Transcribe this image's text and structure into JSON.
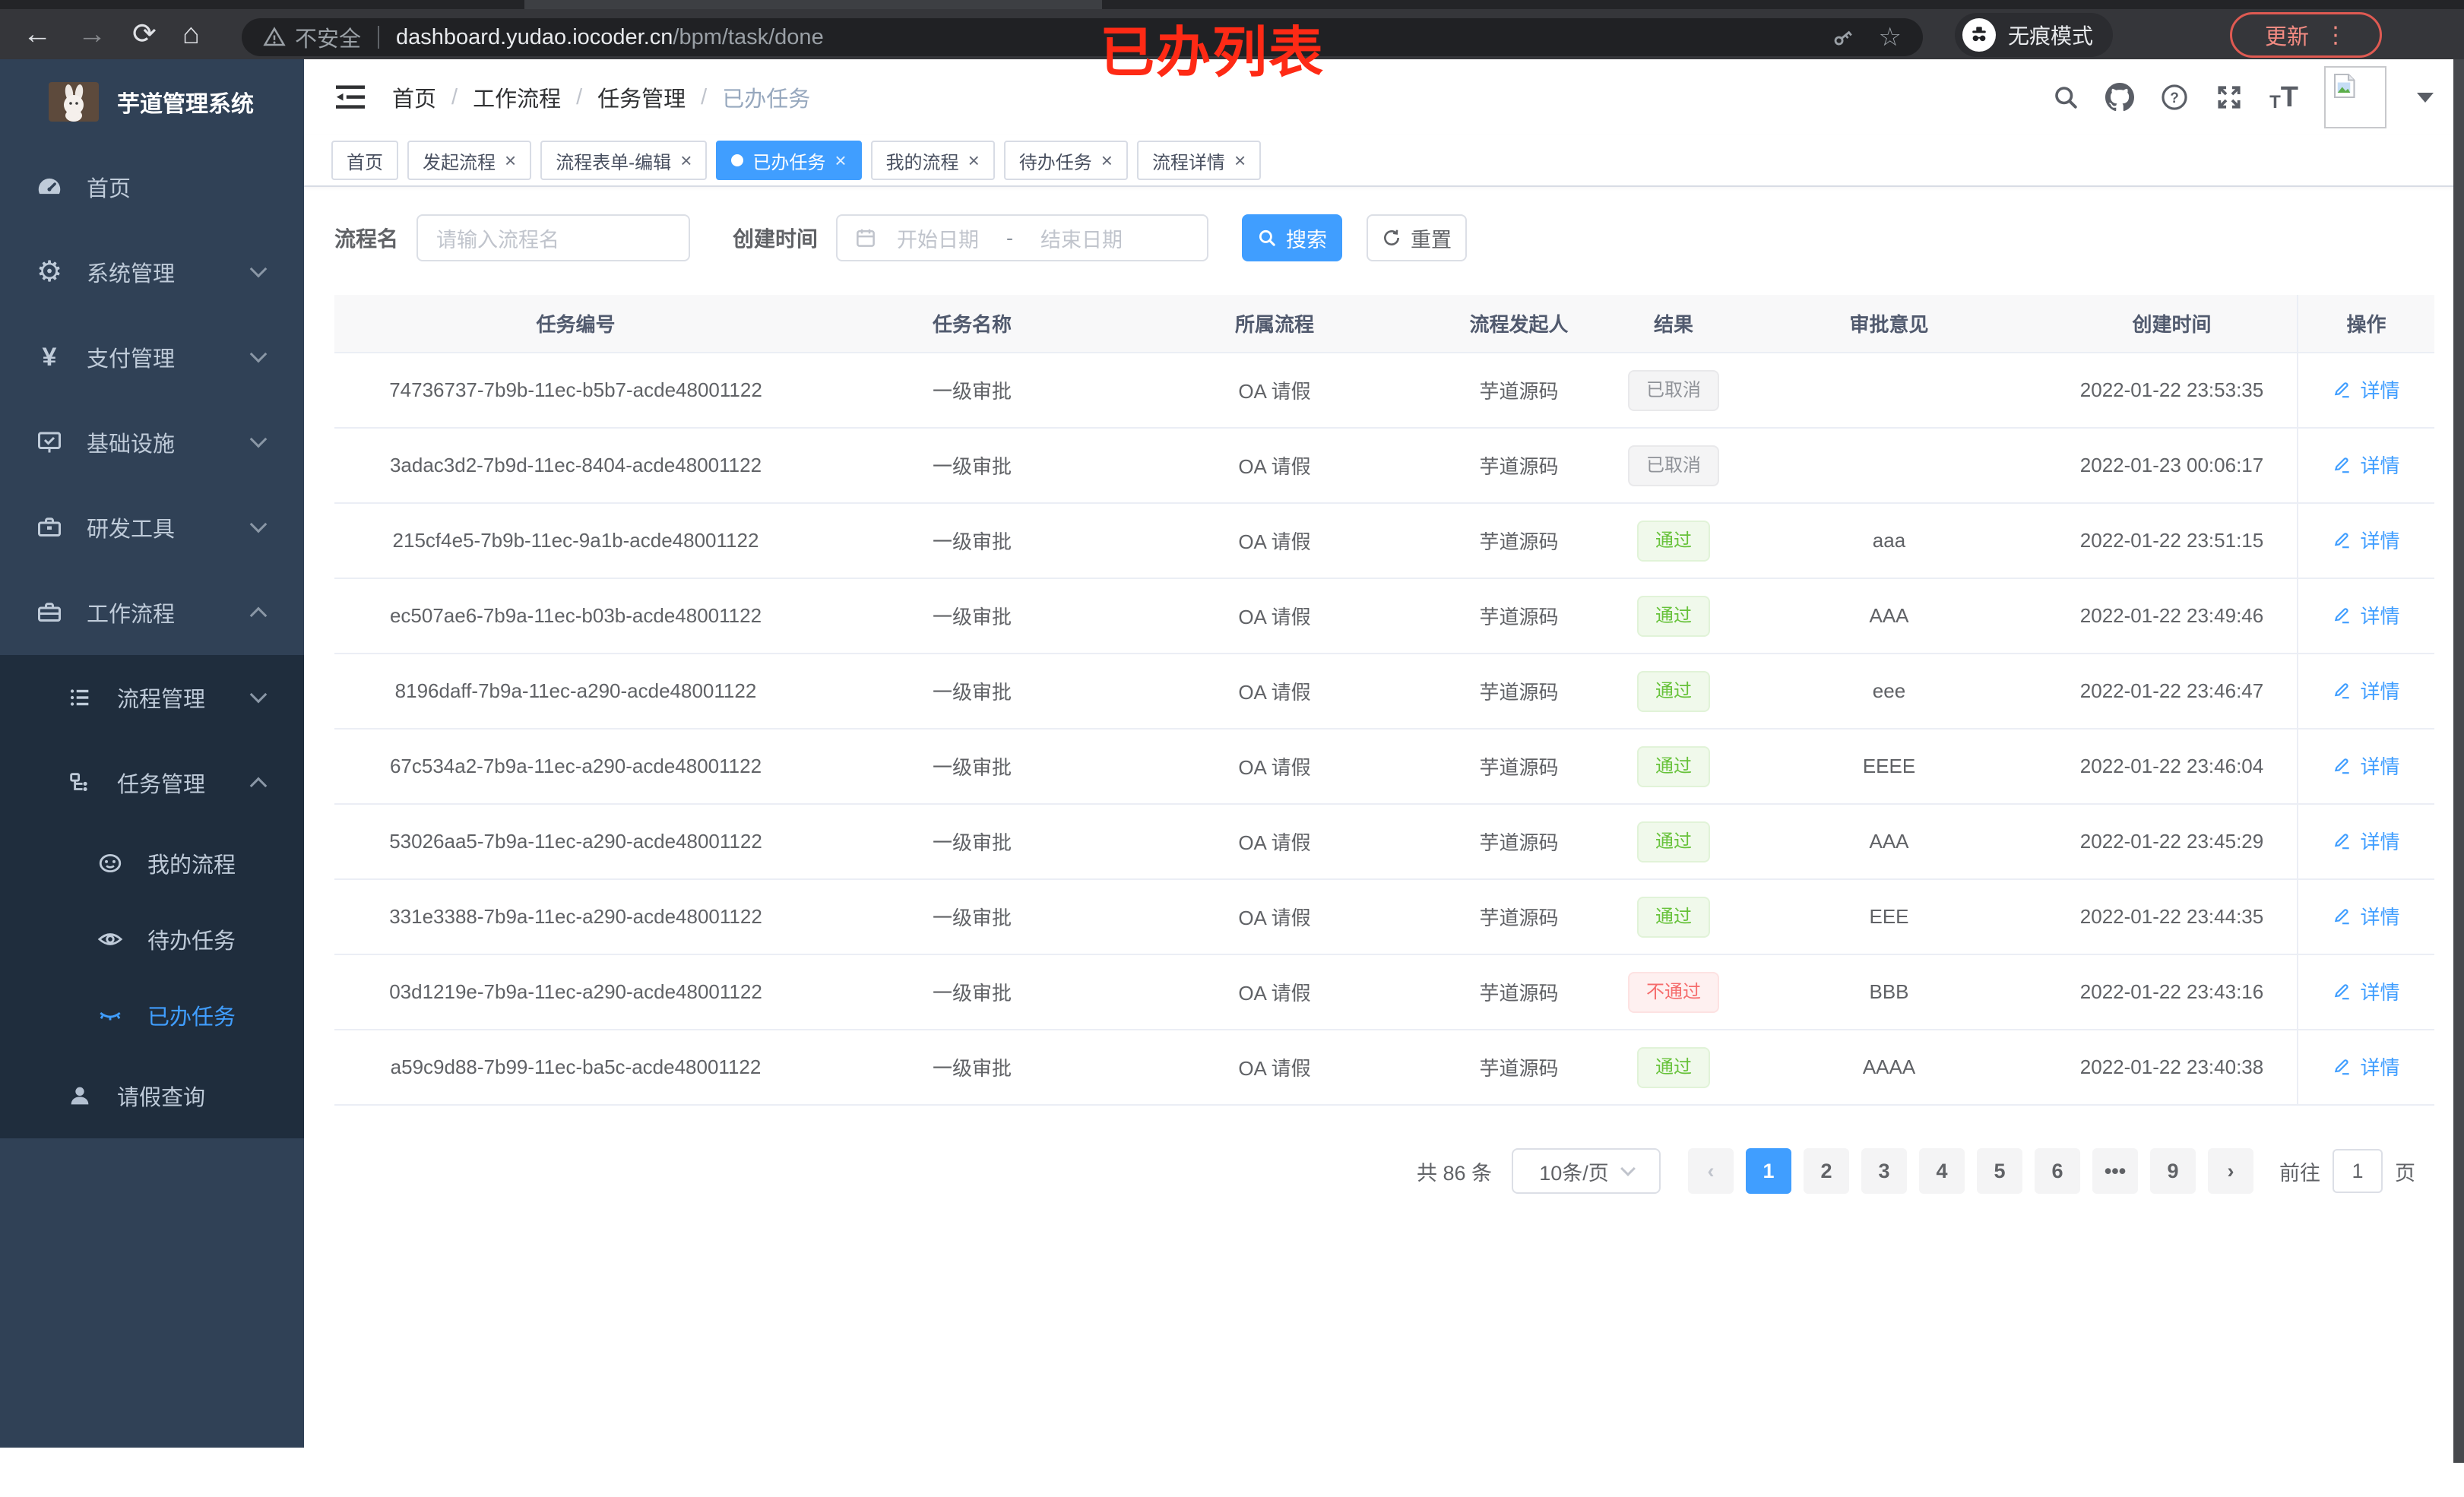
{
  "browser": {
    "security_label": "不安全",
    "url_host": "dashboard.yudao.iocoder.cn",
    "url_path": "/bpm/task/done",
    "incognito_label": "无痕模式",
    "update_label": "更新",
    "kebab": "⋮",
    "back": "←",
    "forward": "→",
    "reload": "⟳",
    "home": "⌂",
    "star": "☆"
  },
  "annotation": "已办列表",
  "sidebar": {
    "title": "芋道管理系统",
    "menu": [
      {
        "label": "首页"
      },
      {
        "label": "系统管理"
      },
      {
        "label": "支付管理"
      },
      {
        "label": "基础设施"
      },
      {
        "label": "研发工具"
      },
      {
        "label": "工作流程"
      },
      {
        "label": "流程管理"
      },
      {
        "label": "任务管理"
      },
      {
        "label": "我的流程"
      },
      {
        "label": "待办任务"
      },
      {
        "label": "已办任务"
      },
      {
        "label": "请假查询"
      }
    ],
    "yen_glyph": "¥",
    "gear_glyph": "⚙"
  },
  "navbar": {
    "breadcrumb": [
      "首页",
      "工作流程",
      "任务管理",
      "已办任务"
    ],
    "separator": "/"
  },
  "tabs": [
    {
      "label": "首页",
      "closable": false,
      "active": false
    },
    {
      "label": "发起流程",
      "closable": true,
      "active": false
    },
    {
      "label": "流程表单-编辑",
      "closable": true,
      "active": false
    },
    {
      "label": "已办任务",
      "closable": true,
      "active": true
    },
    {
      "label": "我的流程",
      "closable": true,
      "active": false
    },
    {
      "label": "待办任务",
      "closable": true,
      "active": false
    },
    {
      "label": "流程详情",
      "closable": true,
      "active": false
    }
  ],
  "filters": {
    "name_label": "流程名",
    "name_placeholder": "请输入流程名",
    "date_label": "创建时间",
    "date_start_placeholder": "开始日期",
    "date_separator": "-",
    "date_end_placeholder": "结束日期",
    "search_label": "搜索",
    "reset_label": "重置"
  },
  "table": {
    "columns": [
      "任务编号",
      "任务名称",
      "所属流程",
      "流程发起人",
      "结果",
      "审批意见",
      "创建时间",
      "操作"
    ],
    "action_label": "详情",
    "rows": [
      {
        "id": "74736737-7b9b-11ec-b5b7-acde48001122",
        "name": "一级审批",
        "process": "OA 请假",
        "starter": "芋道源码",
        "result": "已取消",
        "result_type": "info",
        "comment": "",
        "created": "2022-01-22 23:53:35"
      },
      {
        "id": "3adac3d2-7b9d-11ec-8404-acde48001122",
        "name": "一级审批",
        "process": "OA 请假",
        "starter": "芋道源码",
        "result": "已取消",
        "result_type": "info",
        "comment": "",
        "created": "2022-01-23 00:06:17"
      },
      {
        "id": "215cf4e5-7b9b-11ec-9a1b-acde48001122",
        "name": "一级审批",
        "process": "OA 请假",
        "starter": "芋道源码",
        "result": "通过",
        "result_type": "success",
        "comment": "aaa",
        "created": "2022-01-22 23:51:15"
      },
      {
        "id": "ec507ae6-7b9a-11ec-b03b-acde48001122",
        "name": "一级审批",
        "process": "OA 请假",
        "starter": "芋道源码",
        "result": "通过",
        "result_type": "success",
        "comment": "AAA",
        "created": "2022-01-22 23:49:46"
      },
      {
        "id": "8196daff-7b9a-11ec-a290-acde48001122",
        "name": "一级审批",
        "process": "OA 请假",
        "starter": "芋道源码",
        "result": "通过",
        "result_type": "success",
        "comment": "eee",
        "created": "2022-01-22 23:46:47"
      },
      {
        "id": "67c534a2-7b9a-11ec-a290-acde48001122",
        "name": "一级审批",
        "process": "OA 请假",
        "starter": "芋道源码",
        "result": "通过",
        "result_type": "success",
        "comment": "EEEE",
        "created": "2022-01-22 23:46:04"
      },
      {
        "id": "53026aa5-7b9a-11ec-a290-acde48001122",
        "name": "一级审批",
        "process": "OA 请假",
        "starter": "芋道源码",
        "result": "通过",
        "result_type": "success",
        "comment": "AAA",
        "created": "2022-01-22 23:45:29"
      },
      {
        "id": "331e3388-7b9a-11ec-a290-acde48001122",
        "name": "一级审批",
        "process": "OA 请假",
        "starter": "芋道源码",
        "result": "通过",
        "result_type": "success",
        "comment": "EEE",
        "created": "2022-01-22 23:44:35"
      },
      {
        "id": "03d1219e-7b9a-11ec-a290-acde48001122",
        "name": "一级审批",
        "process": "OA 请假",
        "starter": "芋道源码",
        "result": "不通过",
        "result_type": "danger",
        "comment": "BBB",
        "created": "2022-01-22 23:43:16"
      },
      {
        "id": "a59c9d88-7b99-11ec-ba5c-acde48001122",
        "name": "一级审批",
        "process": "OA 请假",
        "starter": "芋道源码",
        "result": "通过",
        "result_type": "success",
        "comment": "AAAA",
        "created": "2022-01-22 23:40:38"
      }
    ]
  },
  "pagination": {
    "total": "共 86 条",
    "page_size": "10条/页",
    "prev": "‹",
    "next": "›",
    "pages": [
      {
        "label": "1",
        "active": true
      },
      {
        "label": "2",
        "active": false
      },
      {
        "label": "3",
        "active": false
      },
      {
        "label": "4",
        "active": false
      },
      {
        "label": "5",
        "active": false
      },
      {
        "label": "6",
        "active": false
      },
      {
        "label": "•••",
        "active": false
      },
      {
        "label": "9",
        "active": false
      }
    ],
    "goto_label": "前往",
    "goto_value": "1",
    "goto_unit": "页"
  },
  "colors": {
    "accent": "#409eff",
    "success": "#67c23a",
    "danger": "#f56c6c",
    "info": "#909399",
    "sidebar_bg": "#304156",
    "submenu_bg": "#1f2d3d",
    "annotation_red": "#fe2a15"
  }
}
